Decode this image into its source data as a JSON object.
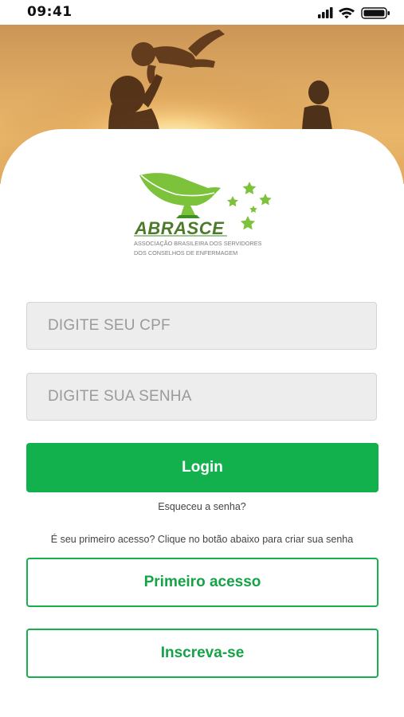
{
  "status_bar": {
    "time": "09:41"
  },
  "logo": {
    "name": "ABRASCE",
    "subtitle_line1": "ASSOCIAÇÃO BRASILEIRA DOS SERVIDORES",
    "subtitle_line2": "DOS CONSELHOS DE ENFERMAGEM"
  },
  "form": {
    "cpf_placeholder": "DIGITE SEU CPF",
    "password_placeholder": "DIGITE SUA SENHA",
    "login_label": "Login",
    "forgot_password": "Esqueceu a senha?",
    "first_access_hint": "É seu primeiro acesso? Clique no botão abaixo para criar sua senha",
    "first_access_label": "Primeiro acesso",
    "signup_label": "Inscreva-se"
  },
  "colors": {
    "primary_green": "#13b14e",
    "logo_green": "#7cc23a"
  }
}
